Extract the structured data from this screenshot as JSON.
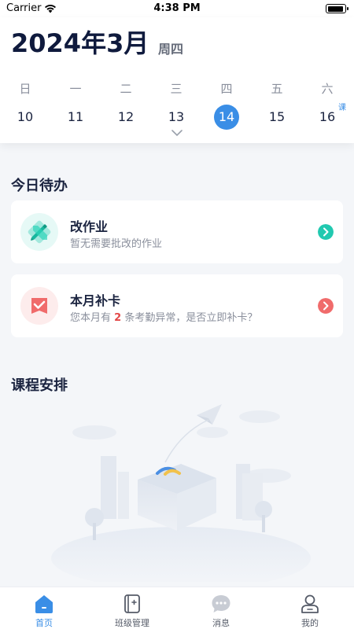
{
  "status_bar": {
    "carrier": "Carrier",
    "time": "4:38 PM",
    "battery_level": 0.95
  },
  "header": {
    "month_title": "2024年3月",
    "weekday": "周四",
    "week": [
      {
        "name": "日",
        "num": "10",
        "badge": ""
      },
      {
        "name": "一",
        "num": "11",
        "badge": ""
      },
      {
        "name": "二",
        "num": "12",
        "badge": ""
      },
      {
        "name": "三",
        "num": "13",
        "badge": ""
      },
      {
        "name": "四",
        "num": "14",
        "badge": "",
        "selected": true
      },
      {
        "name": "五",
        "num": "15",
        "badge": ""
      },
      {
        "name": "六",
        "num": "16",
        "badge": "课"
      }
    ]
  },
  "todo": {
    "title": "今日待办",
    "homework": {
      "title": "改作业",
      "subtitle": "暂无需要批改的作业"
    },
    "attendance": {
      "title": "本月补卡",
      "sub_prefix": "您本月有",
      "count": "2",
      "sub_suffix": "条考勤异常，是否立即补卡？"
    }
  },
  "schedule": {
    "title": "课程安排"
  },
  "tabbar": {
    "tabs": [
      {
        "label": "首页",
        "active": true
      },
      {
        "label": "班级管理"
      },
      {
        "label": "消息"
      },
      {
        "label": "我的"
      }
    ]
  },
  "colors": {
    "accent": "#3a8ee6",
    "teal": "#21c9b0",
    "coral": "#f06b6b",
    "highlight": "#e34848"
  }
}
